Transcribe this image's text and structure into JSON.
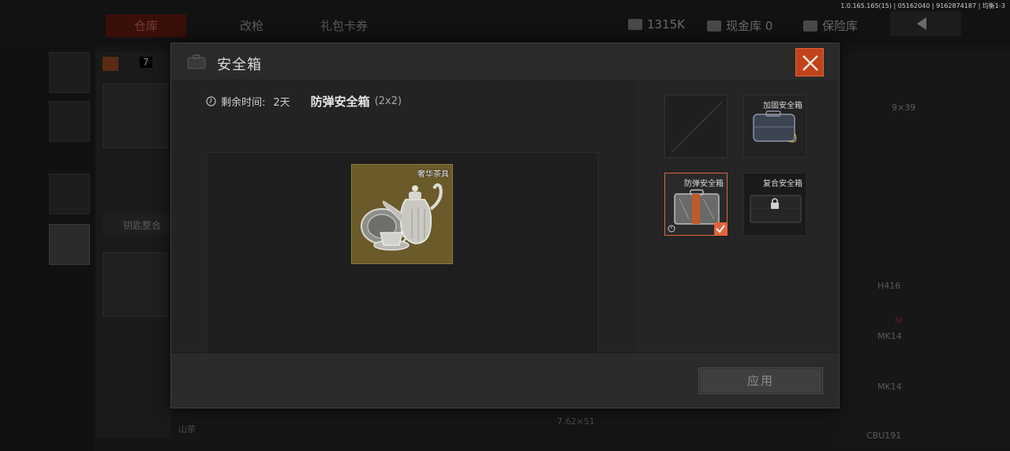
{
  "background": {
    "version": "1.0.165.165(15) | 05162040 | 9162874187 | 均衡1-3",
    "tabs": [
      "仓库",
      "改枪",
      "礼包卡券"
    ],
    "currency": "1315K",
    "cash_vault": "现金库 0",
    "insurance_vault": "保险库",
    "left_number": "7",
    "key_label": "钥匙整合",
    "right_labels": [
      "H416",
      "MK14",
      "MK14",
      "CBU191"
    ],
    "bottom_texts": [
      "山茶",
      "7.62×51"
    ],
    "top_right_label": "9×39"
  },
  "modal": {
    "title": "安全箱",
    "remaining_label": "剩余时间:",
    "remaining_value": "2天",
    "case_name": "防弹安全箱",
    "case_size": "(2x2)",
    "stored_item": {
      "name": "奢华茶具",
      "icon": "tea-set-icon"
    },
    "case_options": [
      {
        "name": "",
        "state": "empty"
      },
      {
        "name": "加固安全箱",
        "state": "available"
      },
      {
        "name": "防弹安全箱",
        "state": "selected"
      },
      {
        "name": "复合安全箱",
        "state": "locked"
      }
    ],
    "apply_label": "应用"
  },
  "colors": {
    "accent": "#e0653a",
    "item_gold": "#6b5a2a",
    "panel": "#262626"
  }
}
